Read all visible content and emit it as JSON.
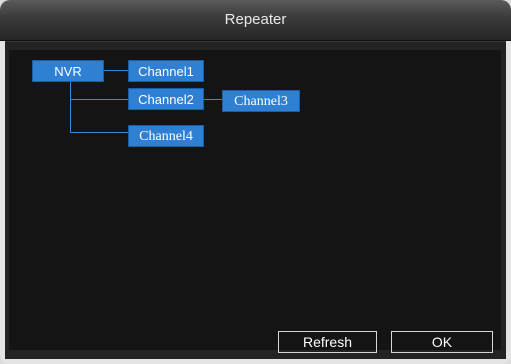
{
  "window": {
    "title": "Repeater"
  },
  "tree": {
    "root": "NVR",
    "channel1": "Channel1",
    "channel2": "Channel2",
    "channel3": "Channel3",
    "channel4": "Channel4"
  },
  "buttons": {
    "refresh": "Refresh",
    "ok": "OK"
  },
  "colors": {
    "node": "#2f7fd3",
    "background": "#141414"
  }
}
